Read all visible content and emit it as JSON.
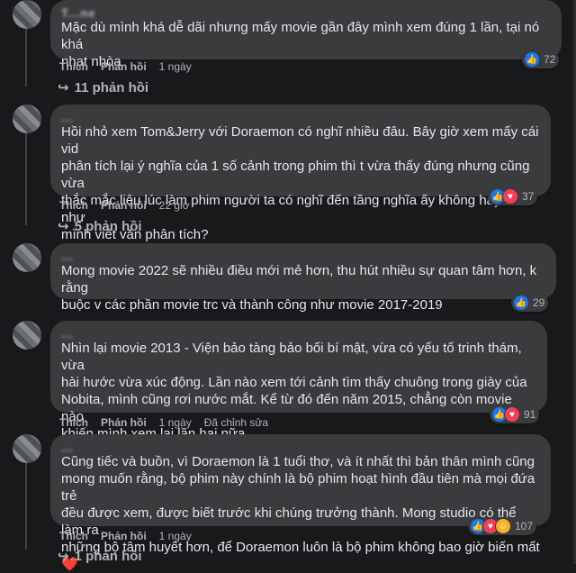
{
  "comments": [
    {
      "author": "T...ne",
      "text": "Mặc dù mình khá dễ dãi nhưng mấy movie gần đây mình xem đúng 1 lần, tại nó khá\nnhạt nhòa",
      "like": "Thích",
      "reply": "Phản hồi",
      "time": "1 ngày",
      "edited": "",
      "reactions": [
        "like-icon"
      ],
      "count": "72",
      "replies": "11 phản hồi"
    },
    {
      "author": "...",
      "text": "Hồi nhỏ xem Tom&Jerry với Doraemon có nghĩ nhiều đâu. Bây giờ xem mấy cái vid\nphân tích lại ý nghĩa của 1 số cảnh trong phim thì t vừa thấy đúng nhưng cũng vừa\nthắc mắc liệu lúc làm phim người ta có nghĩ đến tầng nghĩa ấy không hay chỉ như\nmình viết văn phân tích?",
      "like": "Thích",
      "reply": "Phản hồi",
      "time": "22 giờ",
      "edited": "",
      "reactions": [
        "like-icon",
        "love-icon"
      ],
      "count": "37",
      "replies": "5 phản hồi"
    },
    {
      "author": "...",
      "text": "Mong movie 2022 sẽ nhiều điều mới mẻ hơn, thu hút nhiều sự quan tâm hơn, k rằng\nbuộc v các phần movie trc và thành công như movie 2017-2019",
      "like": "",
      "reply": "",
      "time": "",
      "edited": "",
      "reactions": [
        "like-icon"
      ],
      "count": "29",
      "replies": ""
    },
    {
      "author": "...",
      "text": "Nhìn lại movie 2013 - Viện bảo tàng bảo bối bí mật, vừa có yếu tố trinh thám, vừa\nhài hước vừa xúc động. Lần nào xem tới cảnh tìm thấy chuông trong giày của\nNobita, mình cũng rơi nước mắt. Kể từ đó đến năm 2015, chẳng còn movie nào\nkhiến mình xem lại lần hai nữa.",
      "like": "Thích",
      "reply": "Phản hồi",
      "time": "1 ngày",
      "edited": "Đã chỉnh sửa",
      "reactions": [
        "like-icon",
        "love-icon"
      ],
      "count": "91",
      "replies": ""
    },
    {
      "author": "...",
      "text": "Cũng tiếc và buồn, vì Doraemon là 1 tuổi thơ, và ít nhất thì bản thân mình cũng\nmong muốn rằng, bộ phim này chính là bộ phim hoạt hình đầu tiên mà mọi đứa trẻ\nđều được xem, được biết trước khi chúng trưởng thành. Mong studio có thể làm ra\nnhững bộ tâm huyết hơn, để Doraemon luôn là bộ phim không bao giờ biến mất ❤️",
      "like": "Thích",
      "reply": "Phản hồi",
      "time": "1 ngày",
      "edited": "",
      "reactions": [
        "like-icon",
        "love-icon",
        "care-icon"
      ],
      "count": "107",
      "replies": "1 phản hồi"
    }
  ],
  "colors": {
    "background": "#18191a",
    "bubble": "#3a3b3c",
    "like": "#1877f2",
    "love": "#f33e58"
  }
}
